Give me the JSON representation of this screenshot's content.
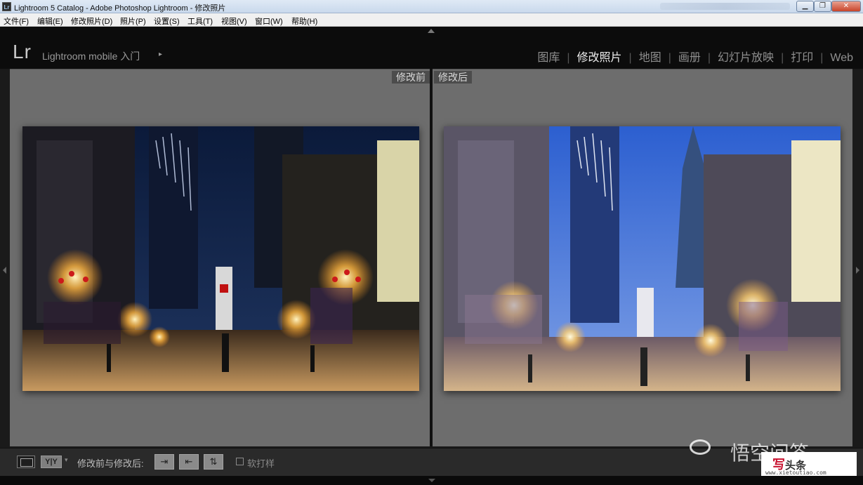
{
  "window": {
    "title": "Lightroom 5 Catalog - Adobe Photoshop Lightroom - 修改照片",
    "app_icon": "Lr",
    "minimize_glyph": "▁",
    "maximize_glyph": "❐",
    "close_glyph": "✕"
  },
  "menu": [
    "文件(F)",
    "编辑(E)",
    "修改照片(D)",
    "照片(P)",
    "设置(S)",
    "工具(T)",
    "视图(V)",
    "窗口(W)",
    "帮助(H)"
  ],
  "identity": {
    "logo": "Lr",
    "mobile_label": "Lightroom mobile 入门",
    "mobile_arrow": "▸"
  },
  "modules": [
    {
      "label": "图库",
      "active": false
    },
    {
      "label": "修改照片",
      "active": true
    },
    {
      "label": "地图",
      "active": false
    },
    {
      "label": "画册",
      "active": false
    },
    {
      "label": "幻灯片放映",
      "active": false
    },
    {
      "label": "打印",
      "active": false
    },
    {
      "label": "Web",
      "active": false
    }
  ],
  "module_separator": "|",
  "compare": {
    "before_label": "修改前",
    "after_label": "修改后"
  },
  "toolbar": {
    "view_mode_label": "Y|Y",
    "view_caret": "▾",
    "before_after_label": "修改前与修改后:",
    "copy_before_to_after": "⇥",
    "copy_after_to_before": "⇤",
    "swap": "⇅",
    "soft_proof_label": "软打样"
  },
  "watermark": {
    "text": "悟空问答",
    "brand_title": "写",
    "brand_subtitle": "头条",
    "brand_url": "www.xietoutiao.com"
  },
  "colors": {
    "accent_module": "#ececec",
    "panel_bg": "#6d6d6d",
    "label_bg": "#4c4c4c"
  }
}
